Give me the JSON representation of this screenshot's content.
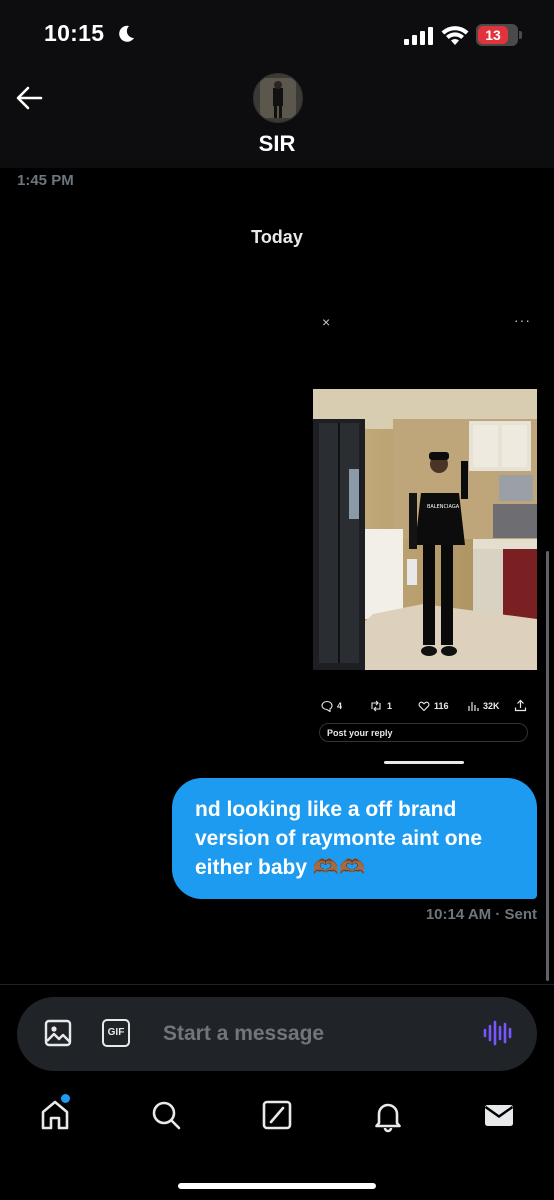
{
  "status_bar": {
    "time": "10:15",
    "battery": "13"
  },
  "conversation": {
    "name": "SIR",
    "previous_timestamp": "1:45 PM",
    "date_separator": "Today"
  },
  "shared_post": {
    "close": "×",
    "more": "···",
    "shirt_text": "BALENCIAGA",
    "replies": "4",
    "reposts": "1",
    "likes": "116",
    "views": "32K",
    "reply_placeholder": "Post your reply"
  },
  "message": {
    "lines": [
      "nd looking like a off brand",
      "version of raymonte aint one",
      "either baby 🫶🏾🫶🏾"
    ],
    "time": "10:14 AM",
    "status": "· Sent"
  },
  "composer": {
    "gif_label": "GIF",
    "placeholder": "Start a message"
  },
  "colors": {
    "accent": "#1d9bf0",
    "background": "#000000",
    "composer": "#202327",
    "voice": "#7856ff"
  },
  "nav": {
    "icons": [
      "home-icon",
      "search-icon",
      "grok-icon",
      "notifications-icon",
      "messages-icon"
    ]
  }
}
